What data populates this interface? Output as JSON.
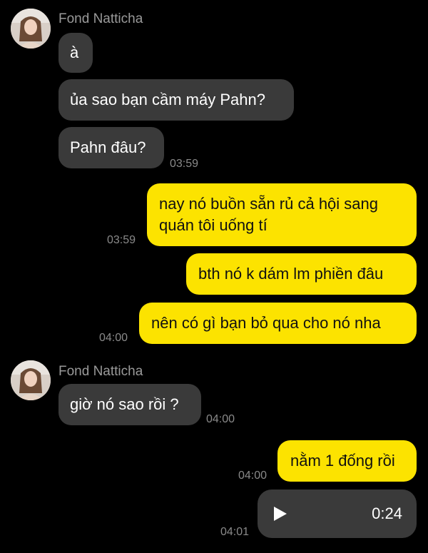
{
  "contact": {
    "name_1": "Fond Natticha",
    "name_2": "Fond Natticha"
  },
  "messages": [
    {
      "side": "in",
      "text": "à"
    },
    {
      "side": "in",
      "text": "ủa sao bạn cầm máy Pahn?"
    },
    {
      "side": "in",
      "text": "Pahn đâu?",
      "time": "03:59"
    },
    {
      "side": "out",
      "text": "nay nó buồn sẵn rủ cả hội sang quán tôi uống tí",
      "line1": "nay nó buồn sẵn rủ cả hội sang",
      "line2": "quán tôi uống tí",
      "time": "03:59"
    },
    {
      "side": "out",
      "text": "bth nó k dám lm phiền đâu"
    },
    {
      "side": "out",
      "text": "nên có gì bạn bỏ qua cho nó nha",
      "time": "04:00"
    },
    {
      "side": "in",
      "text": "giờ nó sao rồi ?",
      "time": "04:00"
    },
    {
      "side": "out",
      "text": "nằm 1 đống rồi",
      "time": "04:00"
    },
    {
      "side": "out",
      "type": "voice",
      "duration": "0:24",
      "time": "04:01"
    }
  ],
  "icons": {
    "play": "play-icon"
  },
  "colors": {
    "background": "#000000",
    "incoming": "#3a3a3a",
    "outgoing": "#fce300"
  }
}
